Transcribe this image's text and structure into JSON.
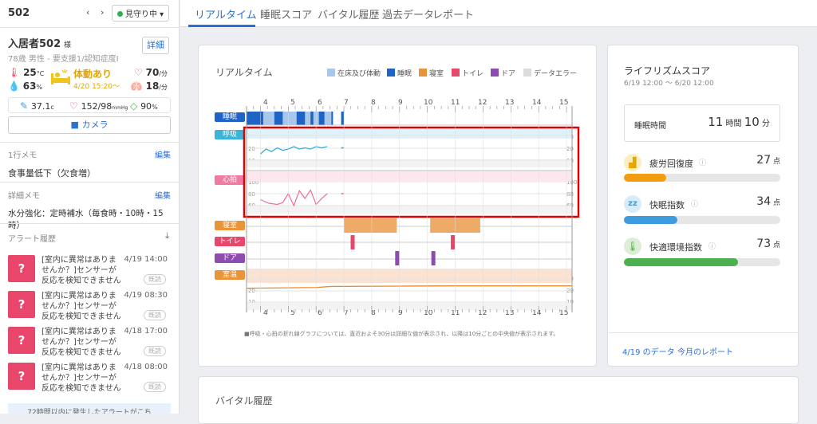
{
  "left": {
    "room": "502",
    "prev": "‹",
    "next": "›",
    "watch_status": "見守り中",
    "resident_name": "入居者502",
    "resident_honorific": "様",
    "resident_info": "78歳 男性 - 要支援1/認知症度I",
    "detail_button": "詳細",
    "temp_room": "25",
    "temp_unit": "°C",
    "humidity": "63",
    "humidity_unit": "%",
    "status_label": "体動あり",
    "status_time": "4/20 15:20〜",
    "heart_rate": "70",
    "heart_unit": "/分",
    "resp_rate": "18",
    "resp_unit": "/分",
    "body_temp": "37.1",
    "body_temp_unit": "c",
    "blood_pressure": "152/98",
    "bp_unit": "mmHg",
    "spo2": "90",
    "spo2_unit": "%",
    "camera_button": "カメラ",
    "memo1_title": "1行メモ",
    "memo1_edit": "編集",
    "memo1_text": "食事量低下（欠食増）",
    "memo2_title": "詳細メモ",
    "memo2_edit": "編集",
    "memo2_text": "水分強化：定時補水（毎食時・10時・15時）",
    "alert_title": "アラート履歴",
    "alerts": [
      {
        "text": "[室内に異常はありませんか？]センサーが反応を検知できません",
        "time": "4/19 14:00",
        "tag": "既読"
      },
      {
        "text": "[室内に異常はありませんか？]センサーが反応を検知できません",
        "time": "4/19 08:30",
        "tag": "既読"
      },
      {
        "text": "[室内に異常はありませんか？]センサーが反応を検知できません",
        "time": "4/18 17:00",
        "tag": "既読"
      },
      {
        "text": "[室内に異常はありませんか？]センサーが反応を検知できません",
        "time": "4/18 08:00",
        "tag": "既読"
      }
    ],
    "footer_note": "72時間以内に発生したアラートがこち"
  },
  "tabs": [
    "リアルタイム",
    "睡眠スコア",
    "バイタル履歴",
    "過去データ",
    "レポート"
  ],
  "realtime": {
    "title": "リアルタイム",
    "legend": [
      {
        "label": "在床及び体動",
        "color": "#a9c7ea"
      },
      {
        "label": "睡眠",
        "color": "#1f63c6"
      },
      {
        "label": "寝室",
        "color": "#e9943a"
      },
      {
        "label": "トイレ",
        "color": "#e8466b"
      },
      {
        "label": "ドア",
        "color": "#8e4bb0"
      },
      {
        "label": "データエラー",
        "color": "#dcdcdc"
      }
    ],
    "row_labels": [
      "睡眠",
      "呼吸",
      "心拍",
      "寝室",
      "トイレ",
      "ドア",
      "室温"
    ],
    "row_colors": [
      "#1f63c6",
      "#3db3d8",
      "#f07aa0",
      "#e9943a",
      "#e8466b",
      "#8e4bb0",
      "#e9943a"
    ],
    "hours": [
      "4",
      "5",
      "6",
      "7",
      "8",
      "9",
      "10",
      "11",
      "12",
      "13",
      "14",
      "15"
    ],
    "resp_axis": [
      "30",
      "20",
      "10"
    ],
    "heart_axis": [
      "100",
      "80",
      "60"
    ],
    "temp_axis": [
      "30",
      "20",
      "10"
    ],
    "footnote": "■呼吸・心拍の折れ線グラフについては、直近およそ30分は詳細な値が表示され、以降は10分ごとの中央値が表示されます。"
  },
  "chart_data": {
    "type": "line",
    "x_unit": "hour",
    "x_range": [
      3.5,
      15.2
    ],
    "sleep_blocks": [
      [
        3.5,
        4.1
      ],
      [
        4.5,
        4.8
      ],
      [
        5.3,
        5.6
      ],
      [
        5.8,
        5.9
      ],
      [
        6.1,
        6.3
      ],
      [
        6.55,
        6.6
      ],
      [
        6.9,
        7.0
      ]
    ],
    "bed_blocks": [
      [
        3.5,
        6.6
      ],
      [
        6.9,
        7.0
      ]
    ],
    "respiration": {
      "x": [
        4.0,
        4.2,
        4.4,
        4.6,
        4.8,
        5.0,
        5.2,
        5.4,
        5.6,
        5.8,
        6.0,
        6.2,
        6.4
      ],
      "y": [
        15,
        19,
        17,
        20,
        18,
        19,
        21,
        19,
        20,
        19,
        21,
        20,
        21
      ],
      "ylim": [
        10,
        30
      ]
    },
    "heart_rate": {
      "x": [
        4.0,
        4.3,
        4.6,
        4.8,
        5.0,
        5.2,
        5.4,
        5.6,
        5.8,
        6.0,
        6.2,
        6.4
      ],
      "y": [
        70,
        64,
        62,
        65,
        80,
        60,
        85,
        72,
        86,
        62,
        72,
        80
      ],
      "ylim": [
        60,
        100
      ]
    },
    "bedroom_blocks": [
      [
        7.0,
        8.9
      ],
      [
        10.1,
        11.9
      ]
    ],
    "toilet_events": [
      7.3,
      10.9
    ],
    "door_events": [
      8.9,
      10.2
    ],
    "room_temp": {
      "x": [
        3.5,
        6.0,
        6.5,
        9.0,
        11.0,
        13.0,
        15.2
      ],
      "y": [
        22.0,
        22.6,
        23.5,
        23.8,
        24.0,
        24.0,
        24.0
      ],
      "ylim": [
        10,
        30
      ]
    }
  },
  "score": {
    "title": "ライフリズムスコア",
    "period": "6/19 12:00 〜 6/20 12:00",
    "sleep_label": "睡眠時間",
    "sleep_hours": "11",
    "sleep_hours_unit": "時間",
    "sleep_minutes": "10",
    "sleep_minutes_unit": "分",
    "metrics": [
      {
        "label": "疲労回復度",
        "value": "27",
        "unit": "点",
        "percent": 27,
        "color": "#f39c12",
        "icon": "fatigue-recovery-icon"
      },
      {
        "label": "快眠指数",
        "value": "34",
        "unit": "点",
        "percent": 34,
        "color": "#3b9ddd",
        "icon": "sleep-zz-icon"
      },
      {
        "label": "快適環境指数",
        "value": "73",
        "unit": "点",
        "percent": 73,
        "color": "#4cb050",
        "icon": "thermometer-icon"
      }
    ],
    "link1": "4/19 のデータ",
    "link2": "今月のレポート"
  },
  "vital_title": "バイタル履歴"
}
